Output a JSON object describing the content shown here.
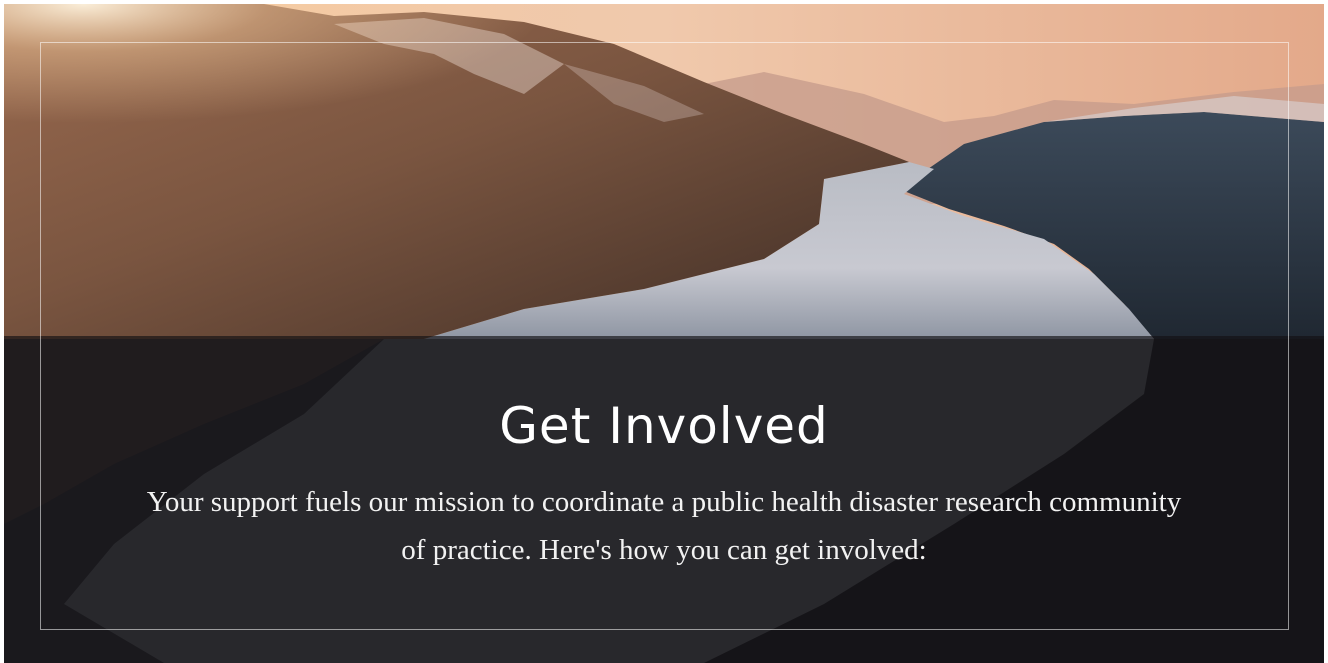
{
  "hero": {
    "title": "Get Involved",
    "description": "Your support fuels our mission to coordinate a public health disaster research community of practice. Here's how you can get involved:",
    "background_image": "mountain-lake-sunset-photo"
  },
  "colors": {
    "overlay": "#121114",
    "text": "#ffffff",
    "frame_border": "#ffffff",
    "sky": "#e8b28e",
    "water": "#c9cfd6"
  }
}
